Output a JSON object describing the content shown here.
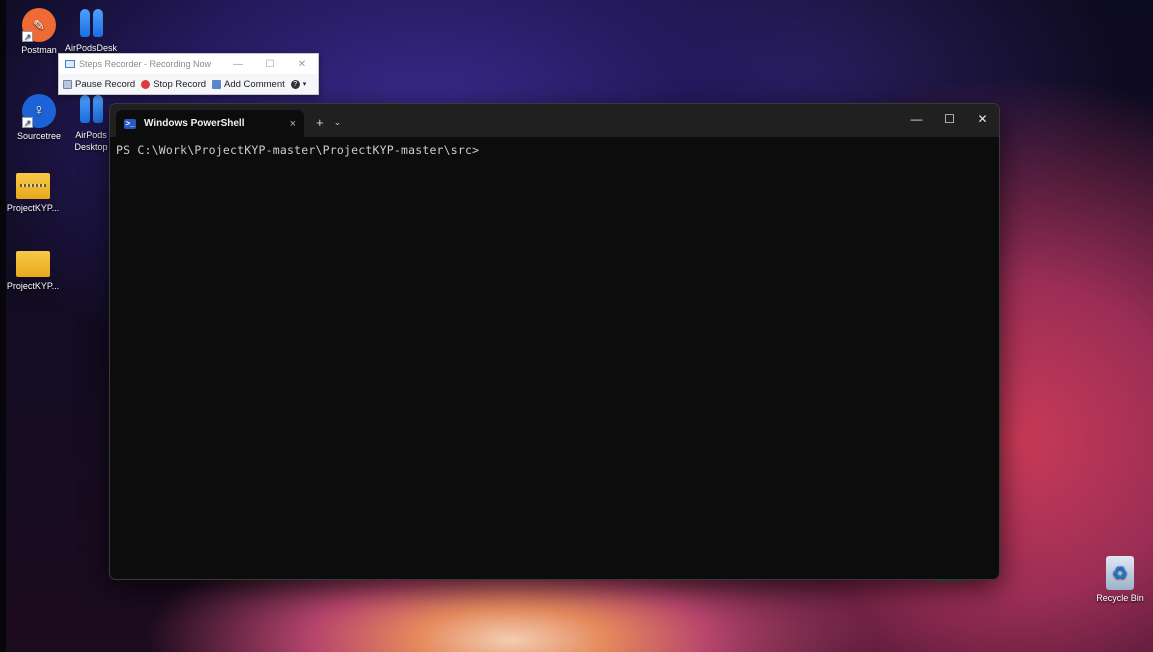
{
  "desktop": {
    "icons": [
      {
        "label": "Postman",
        "icon": "postman-icon"
      },
      {
        "label": "AirPodsDesk",
        "icon": "airpods-icon"
      },
      {
        "label": "Sourcetree",
        "icon": "sourcetree-icon"
      },
      {
        "label": "AirPods Desktop",
        "icon": "airpods-icon"
      },
      {
        "label": "ProjectKYP...",
        "icon": "zip-folder-icon"
      },
      {
        "label": "ProjectKYP...",
        "icon": "folder-icon"
      },
      {
        "label": "Recycle Bin",
        "icon": "recycle-bin-icon"
      }
    ]
  },
  "steps_recorder": {
    "title": "Steps Recorder - Recording Now",
    "pause_label": "Pause Record",
    "stop_label": "Stop Record",
    "comment_label": "Add Comment",
    "help_glyph": "?"
  },
  "terminal": {
    "tab_title": "Windows PowerShell",
    "tab_close": "×",
    "new_tab": "+",
    "dropdown": "⌄",
    "minimize": "—",
    "maximize": "☐",
    "close": "✕",
    "prompt": "PS C:\\Work\\ProjectKYP-master\\ProjectKYP-master\\src>"
  },
  "colors": {
    "terminal_bg": "#0c0c0c",
    "terminal_titlebar": "#202020",
    "powershell_blue": "#2a56c6",
    "stop_red": "#e03b3b"
  }
}
